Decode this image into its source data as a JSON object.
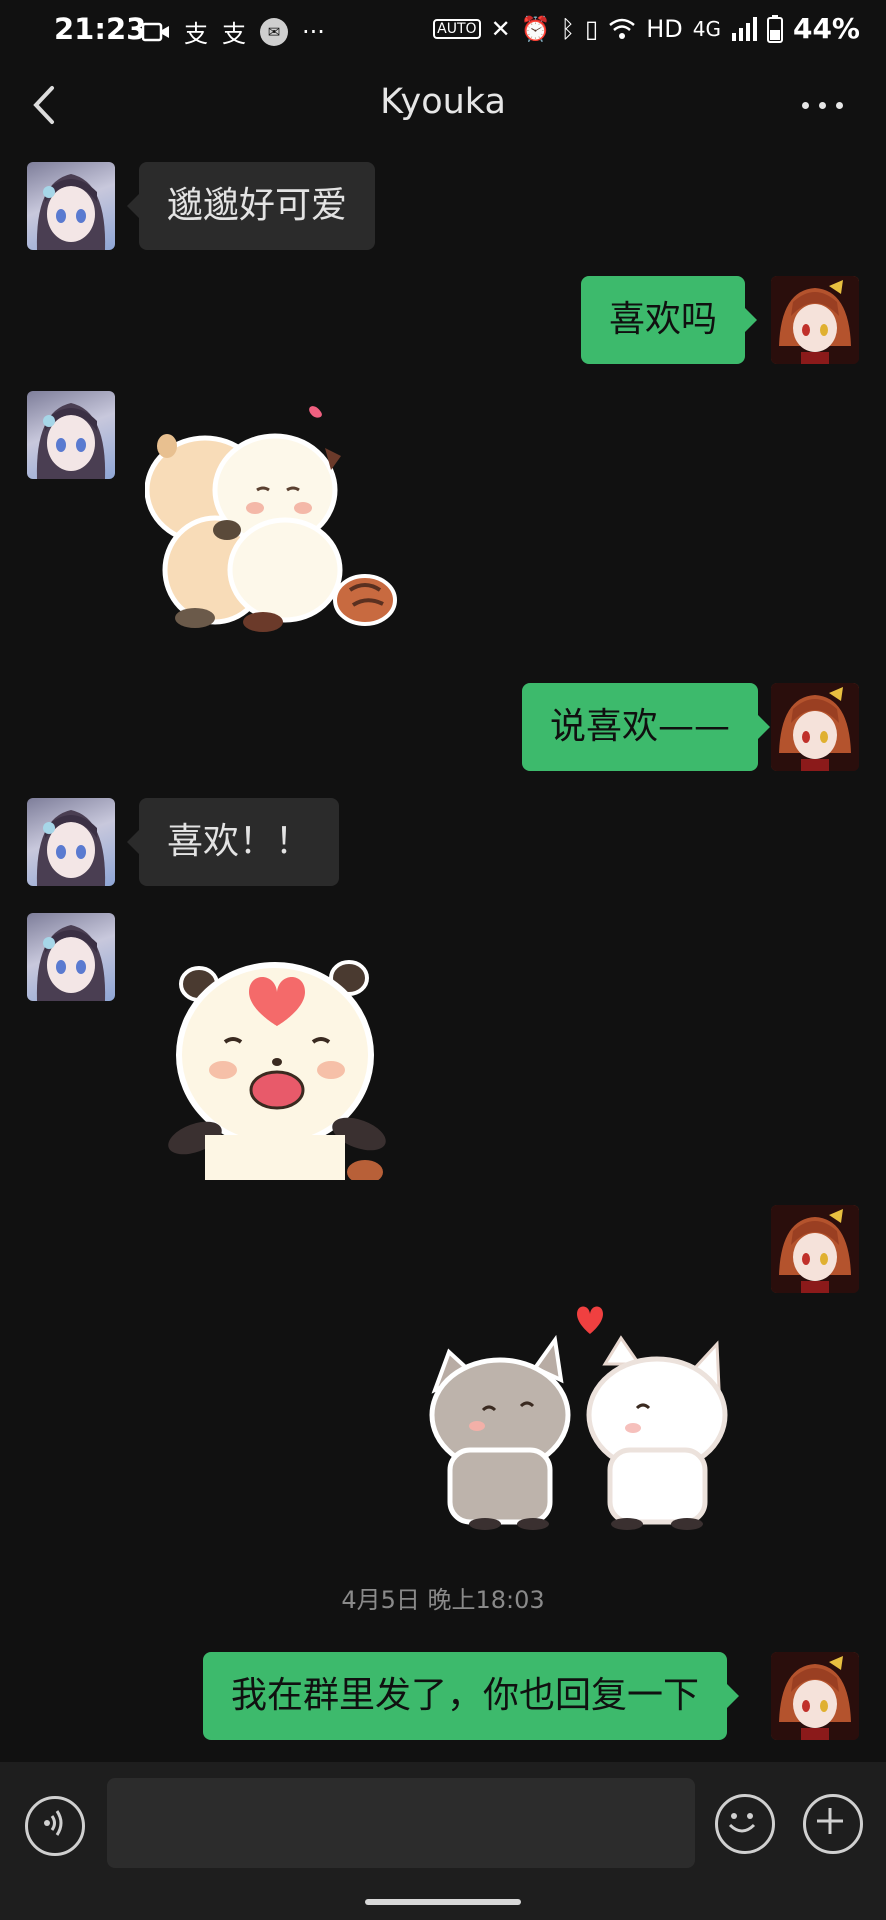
{
  "status_bar": {
    "time": "21:23",
    "hd": "HD",
    "network": "4G",
    "battery": "44%",
    "icons": [
      "video-icon",
      "alipay-icon",
      "alipay-icon",
      "mail-icon",
      "more-dots-icon",
      "auto-hz-icon",
      "x-icon",
      "alarm-icon",
      "bluetooth-icon",
      "vibrate-icon",
      "wifi-icon",
      "signal-icon",
      "battery-icon"
    ]
  },
  "header": {
    "title": "Kyouka"
  },
  "messages": [
    {
      "side": "left",
      "type": "text",
      "text": "邈邈好可爱"
    },
    {
      "side": "right",
      "type": "text",
      "text": "喜欢吗"
    },
    {
      "side": "left",
      "type": "sticker",
      "sticker": "two-bears-hug"
    },
    {
      "side": "right",
      "type": "text",
      "text": "说喜欢——"
    },
    {
      "side": "left",
      "type": "text",
      "text": "喜欢！！"
    },
    {
      "side": "left",
      "type": "sticker",
      "sticker": "bear-heart"
    },
    {
      "side": "right",
      "type": "sticker",
      "sticker": "cats-kiss"
    },
    {
      "side": "right",
      "type": "text",
      "text": "我在群里发了，你也回复一下"
    }
  ],
  "timestamp": "4月5日 晚上18:03",
  "input": {
    "value": "",
    "placeholder": ""
  },
  "colors": {
    "background": "#111111",
    "bubble_left": "#2b2b2b",
    "bubble_right": "#3dba6c"
  }
}
